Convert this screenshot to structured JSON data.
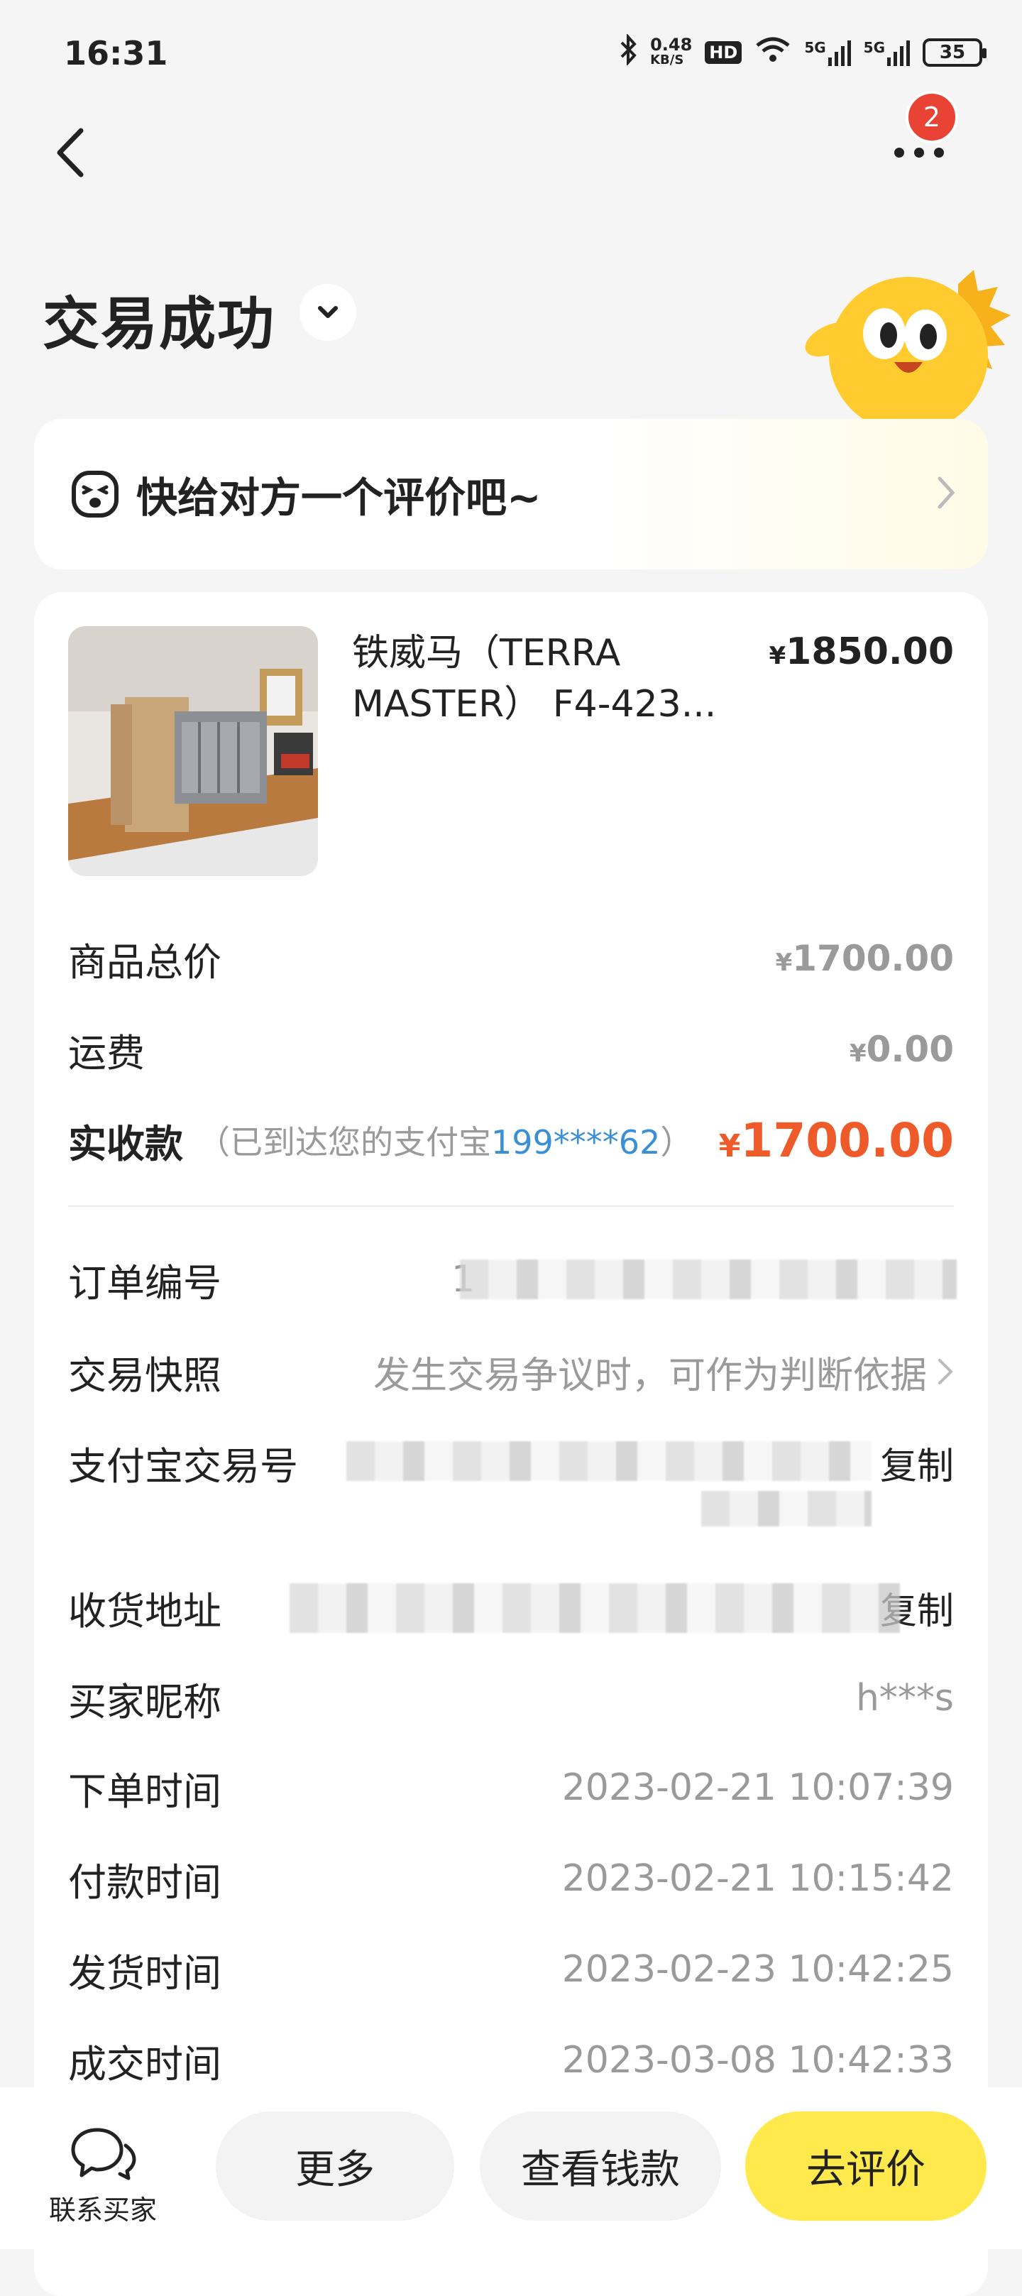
{
  "status_bar": {
    "time": "16:31",
    "net_speed": "0.48",
    "net_unit": "KB/S",
    "hd_label": "HD",
    "signal1": "5G",
    "signal2": "5G",
    "battery": "35"
  },
  "header": {
    "notification_count": "2",
    "title": "交易成功"
  },
  "review_prompt": {
    "text": "快给对方一个评价吧~"
  },
  "product": {
    "name": "铁威马（TERRA MASTER） F4-423...",
    "price_symbol": "¥",
    "price": "1850.00"
  },
  "summary": {
    "goods_total_label": "商品总价",
    "goods_total_symbol": "¥",
    "goods_total": "1700.00",
    "shipping_label": "运费",
    "shipping_symbol": "¥",
    "shipping": "0.00",
    "received_label": "实收款",
    "received_note_prefix": "（已到达您的支付宝",
    "received_account": "199****62",
    "received_note_suffix": "）",
    "received_symbol": "¥",
    "received": "1700.00"
  },
  "details": {
    "order_no_label": "订单编号",
    "order_no_visible": "1",
    "snapshot_label": "交易快照",
    "snapshot_value": "发生交易争议时，可作为判断依据",
    "alipay_no_label": "支付宝交易号",
    "copy_label_1": "复制",
    "address_label": "收货地址",
    "copy_label_2": "复制",
    "buyer_label": "买家昵称",
    "buyer_value": "h***s",
    "order_time_label": "下单时间",
    "order_time": "2023-02-21 10:07:39",
    "pay_time_label": "付款时间",
    "pay_time": "2023-02-21 10:15:42",
    "ship_time_label": "发货时间",
    "ship_time": "2023-02-23 10:42:25",
    "deal_time_label": "成交时间",
    "deal_time": "2023-03-08 10:42:33"
  },
  "bottom_bar": {
    "contact_label": "联系买家",
    "more_label": "更多",
    "money_label": "查看钱款",
    "review_label": "去评价"
  }
}
